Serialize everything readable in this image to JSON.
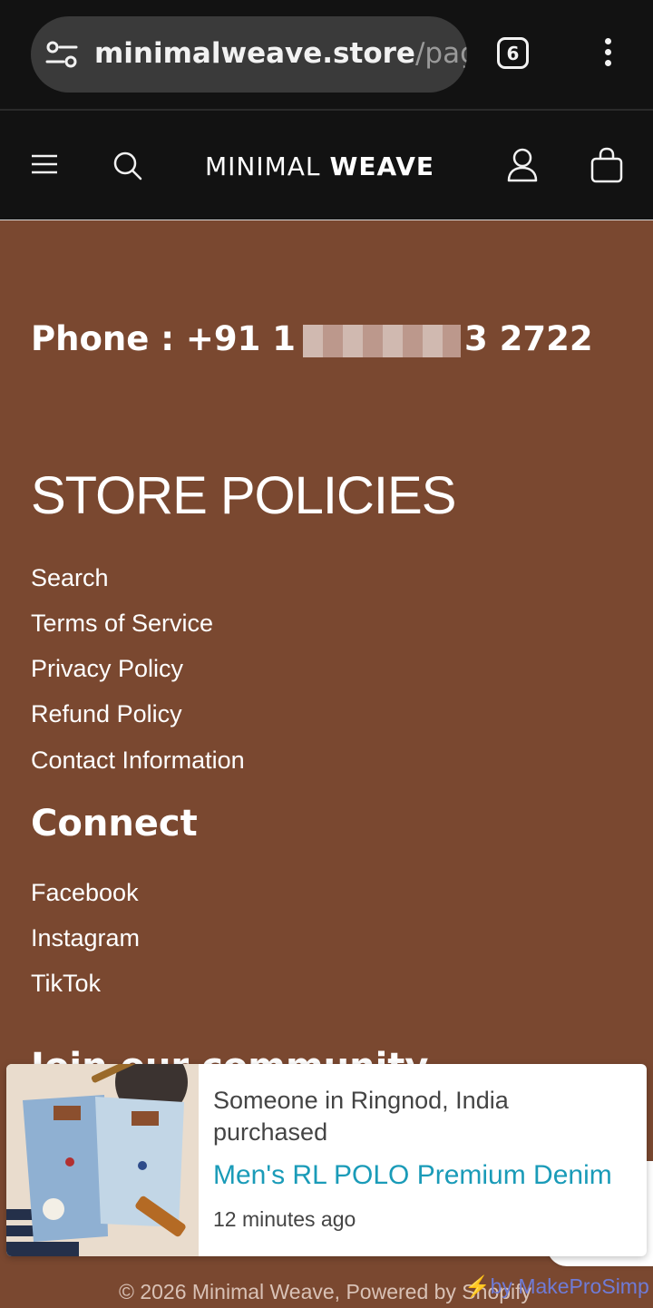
{
  "browser": {
    "url_host": "minimalweave.store",
    "url_path": "/pages",
    "tab_count": "6",
    "icons": {
      "site_info": "site-info-icon",
      "menu": "more-vert-icon"
    }
  },
  "header": {
    "logo_light": "MINIMAL",
    "logo_bold": "WEAVE",
    "icons": [
      "hamburger-icon",
      "search-icon",
      "account-icon",
      "cart-icon"
    ]
  },
  "contact": {
    "phone_prefix": "Phone : +91 1",
    "phone_suffix": "3 2722"
  },
  "policies": {
    "title": "STORE POLICIES",
    "links": [
      "Search",
      "Terms of Service",
      "Privacy Policy",
      "Refund Policy",
      "Contact Information"
    ]
  },
  "connect": {
    "title": "Connect",
    "links": [
      "Facebook",
      "Instagram",
      "TikTok"
    ]
  },
  "peek_heading": "Join our community",
  "popup": {
    "line1": "Someone in Ringnod, India",
    "line2": "purchased",
    "product": "Men's RL POLO Premium Denim",
    "time": "12 minutes ago"
  },
  "footer": {
    "copyright": "© 2026 Minimal Weave, Powered by Shopify",
    "credit": "⚡by MakeProSimp"
  },
  "colors": {
    "background": "#7a4830",
    "header": "#121212",
    "product_link": "#1a9bb8",
    "credit_link": "#6f7bd6"
  }
}
